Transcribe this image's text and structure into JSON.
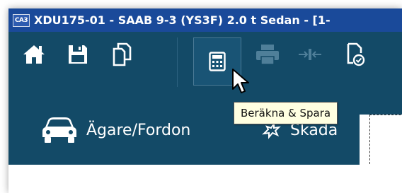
{
  "window": {
    "app_icon_text": "CA3",
    "title": "XDU175-01 - SAAB 9-3 (YS3F) 2.0 t Sedan - [1-"
  },
  "toolbar": {
    "buttons": [
      {
        "name": "home",
        "icon": "home-icon",
        "enabled": true
      },
      {
        "name": "save",
        "icon": "floppy-disk-icon",
        "enabled": true
      },
      {
        "name": "copy",
        "icon": "copy-documents-icon",
        "enabled": true
      },
      {
        "name": "calculate-and-save",
        "icon": "calculator-icon",
        "enabled": true,
        "hovered": true
      },
      {
        "name": "print",
        "icon": "printer-icon",
        "enabled": false
      },
      {
        "name": "compare",
        "icon": "compare-arrows-icon",
        "enabled": false
      },
      {
        "name": "document-check",
        "icon": "document-check-icon",
        "enabled": true
      }
    ],
    "tooltip": "Beräkna & Spara"
  },
  "tabs": [
    {
      "label": "Ägare/Fordon",
      "icon": "car-icon"
    },
    {
      "label": "Skada",
      "icon": "damage-icon"
    }
  ],
  "colors": {
    "titlebar": "#1a4a9a",
    "toolbar": "#134a67",
    "icon": "#ffffff",
    "icon_disabled": "#4f7f99",
    "tooltip_bg": "#ffffe1"
  }
}
